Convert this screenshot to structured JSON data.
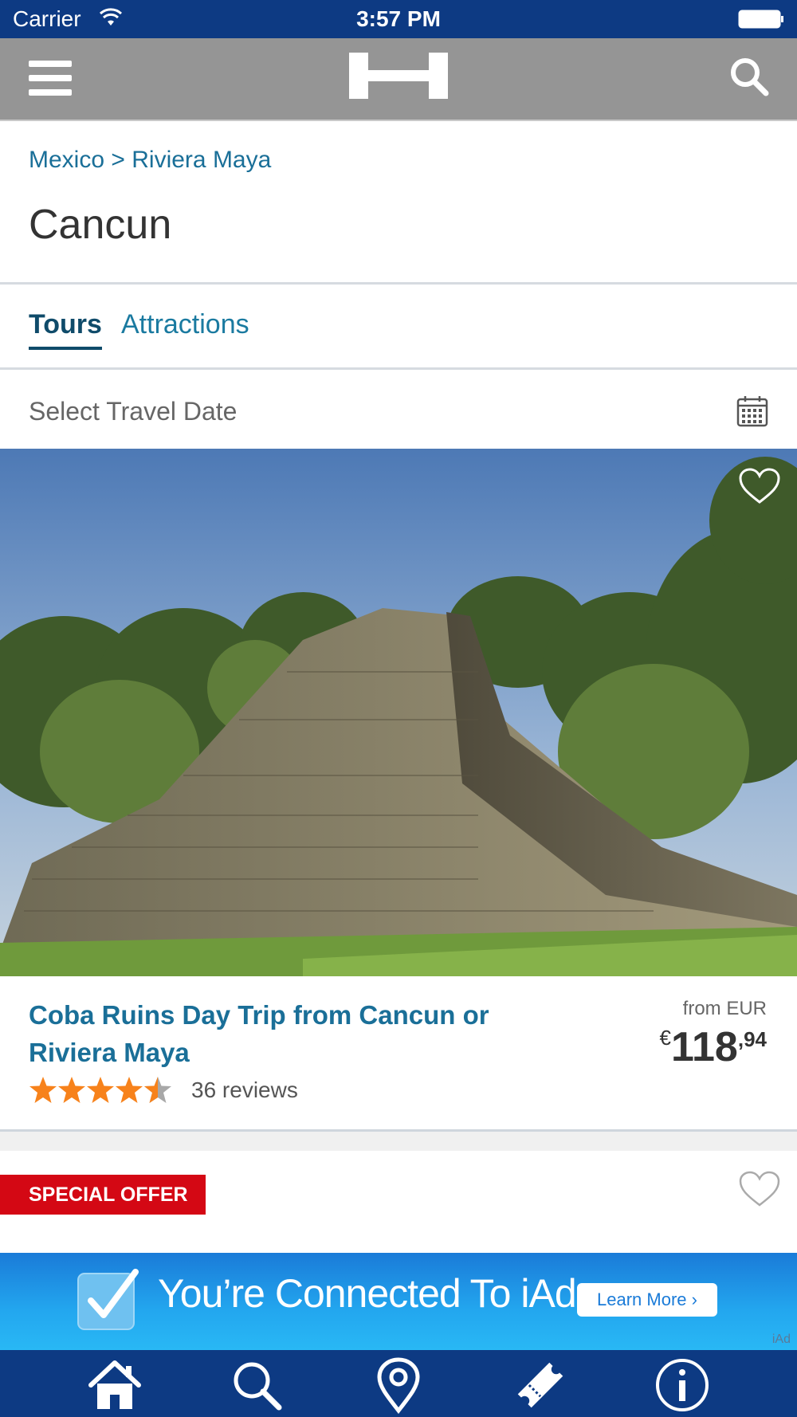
{
  "status_bar": {
    "carrier": "Carrier",
    "time": "3:57 PM"
  },
  "nav": {
    "menu_icon": "hamburger-icon",
    "logo_icon": "brand-logo",
    "search_icon": "search-icon"
  },
  "breadcrumb": {
    "country": "Mexico",
    "separator": ">",
    "region": "Riviera Maya"
  },
  "page_title": "Cancun",
  "tabs": [
    {
      "label": "Tours",
      "active": true
    },
    {
      "label": "Attractions",
      "active": false
    }
  ],
  "date_select": {
    "label": "Select Travel Date",
    "icon": "calendar-icon"
  },
  "tour_card": {
    "title": "Coba Ruins Day Trip from Cancun or Riviera Maya",
    "price_from_label": "from EUR",
    "price_currency": "€",
    "price_integer": "118",
    "price_decimal": ",94",
    "rating": 4.5,
    "rating_max": 5,
    "reviews_label": "36 reviews"
  },
  "offer": {
    "badge": "SPECIAL OFFER"
  },
  "ad": {
    "text": "You’re Connected To iAd",
    "button": "Learn More ›",
    "mark": "iAd"
  },
  "colors": {
    "status_bar": "#0d3a83",
    "nav_bar": "#959595",
    "link": "#1a6f98",
    "offer": "#d40814",
    "star": "#f7821b"
  },
  "bottom_tabs": [
    {
      "icon": "home-icon"
    },
    {
      "icon": "search-icon"
    },
    {
      "icon": "map-pin-icon"
    },
    {
      "icon": "ticket-icon"
    },
    {
      "icon": "info-icon"
    }
  ]
}
